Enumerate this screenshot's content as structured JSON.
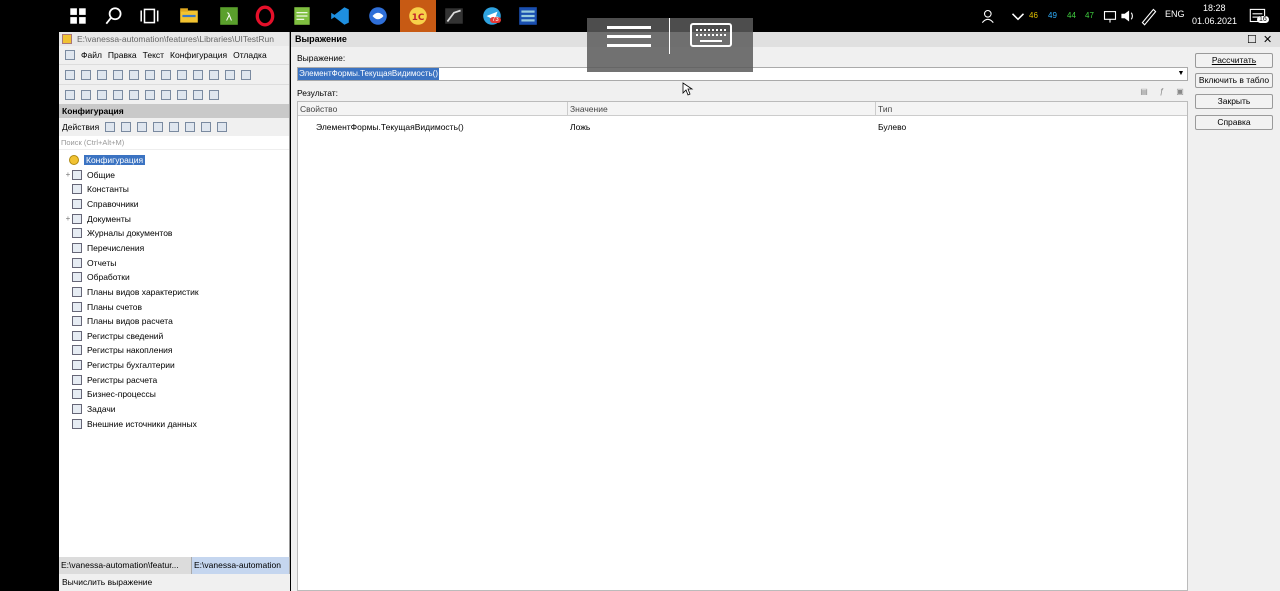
{
  "taskbar": {
    "apps": [
      "windows-start-icon",
      "search-icon",
      "task-view-icon",
      "file-explorer-icon",
      "app-green-icon",
      "opera-icon",
      "notepad-icon",
      "vscode-icon",
      "app-blue-icon",
      "1c-icon",
      "app-dark-icon",
      "telegram-icon",
      "app-grid-icon"
    ],
    "telegram_badge": "73",
    "tray": {
      "nums": [
        "46",
        "49",
        "44",
        "47"
      ],
      "lang": "ENG",
      "time": "18:28",
      "date": "01.06.2021",
      "notifications": "16"
    }
  },
  "left": {
    "title": "E:\\vanessa-automation\\features\\Libraries\\UITestRun",
    "menu": [
      "Файл",
      "Правка",
      "Текст",
      "Конфигурация",
      "Отладка"
    ],
    "config_header": "Конфигурация",
    "actions_label": "Действия",
    "search_placeholder": "Поиск (Ctrl+Alt+M)",
    "tree": [
      {
        "label": "Конфигурация",
        "expander": "",
        "selected": true
      },
      {
        "label": "Общие",
        "expander": "+"
      },
      {
        "label": "Константы",
        "expander": ""
      },
      {
        "label": "Справочники",
        "expander": ""
      },
      {
        "label": "Документы",
        "expander": "+"
      },
      {
        "label": "Журналы документов",
        "expander": ""
      },
      {
        "label": "Перечисления",
        "expander": ""
      },
      {
        "label": "Отчеты",
        "expander": ""
      },
      {
        "label": "Обработки",
        "expander": ""
      },
      {
        "label": "Планы видов характеристик",
        "expander": ""
      },
      {
        "label": "Планы счетов",
        "expander": ""
      },
      {
        "label": "Планы видов расчета",
        "expander": ""
      },
      {
        "label": "Регистры сведений",
        "expander": ""
      },
      {
        "label": "Регистры накопления",
        "expander": ""
      },
      {
        "label": "Регистры бухгалтерии",
        "expander": ""
      },
      {
        "label": "Регистры расчета",
        "expander": ""
      },
      {
        "label": "Бизнес-процессы",
        "expander": ""
      },
      {
        "label": "Задачи",
        "expander": ""
      },
      {
        "label": "Внешние источники данных",
        "expander": ""
      }
    ],
    "tabs": [
      "E:\\vanessa-automation\\featur...",
      "E:\\vanessa-automation"
    ],
    "status": "Вычислить выражение"
  },
  "dialog": {
    "title": "Выражение",
    "expression_label": "Выражение:",
    "expression_value": "ЭлементФормы.ТекущаяВидимость()",
    "result_label": "Результат:",
    "columns": [
      "Свойство",
      "Значение",
      "Тип"
    ],
    "rows": [
      {
        "property": "ЭлементФормы.ТекущаяВидимость()",
        "value": "Ложь",
        "type": "Булево"
      }
    ],
    "buttons": {
      "calculate": "Рассчитать",
      "include_in_table": "Включить в табло",
      "close": "Закрыть",
      "help": "Справка"
    }
  }
}
